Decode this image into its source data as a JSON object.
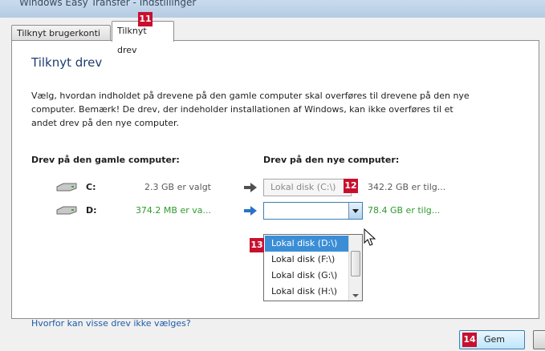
{
  "window": {
    "title": "Windows Easy Transfer - Indstillinger"
  },
  "tabs": [
    {
      "label": "Tilknyt brugerkonti"
    },
    {
      "label": "Tilknyt drev"
    }
  ],
  "page": {
    "heading": "Tilknyt drev",
    "description": "Vælg, hvordan indholdet på drevene på den gamle computer skal overføres til drevene på den nye computer. Bemærk! De drev, der indeholder installationen af Windows, kan ikke overføres til et andet drev på den nye computer.",
    "old_header": "Drev på den gamle computer:",
    "new_header": "Drev på den nye computer:",
    "help_link": "Hvorfor kan visse drev ikke vælges?"
  },
  "drives": [
    {
      "letter": "C:",
      "size": "2.3 GB er valgt",
      "target": "Lokal disk (C:\\)",
      "free": "342.2 GB er tilg..."
    },
    {
      "letter": "D:",
      "size": "374.2 MB er va...",
      "target": "",
      "free": "78.4 GB er tilg..."
    }
  ],
  "dropdown": {
    "options": [
      "Lokal disk (D:\\)",
      "Lokal disk (F:\\)",
      "Lokal disk (G:\\)",
      "Lokal disk (H:\\)"
    ],
    "selected_index": 0
  },
  "buttons": {
    "save": "Gem"
  },
  "badges": [
    "11",
    "12",
    "13",
    "14"
  ],
  "colors": {
    "green": "#2e9a2e",
    "heading": "#1e3c6e",
    "link": "#1e5aa8",
    "badge": "#c8102e",
    "selection": "#3b8ed6"
  }
}
